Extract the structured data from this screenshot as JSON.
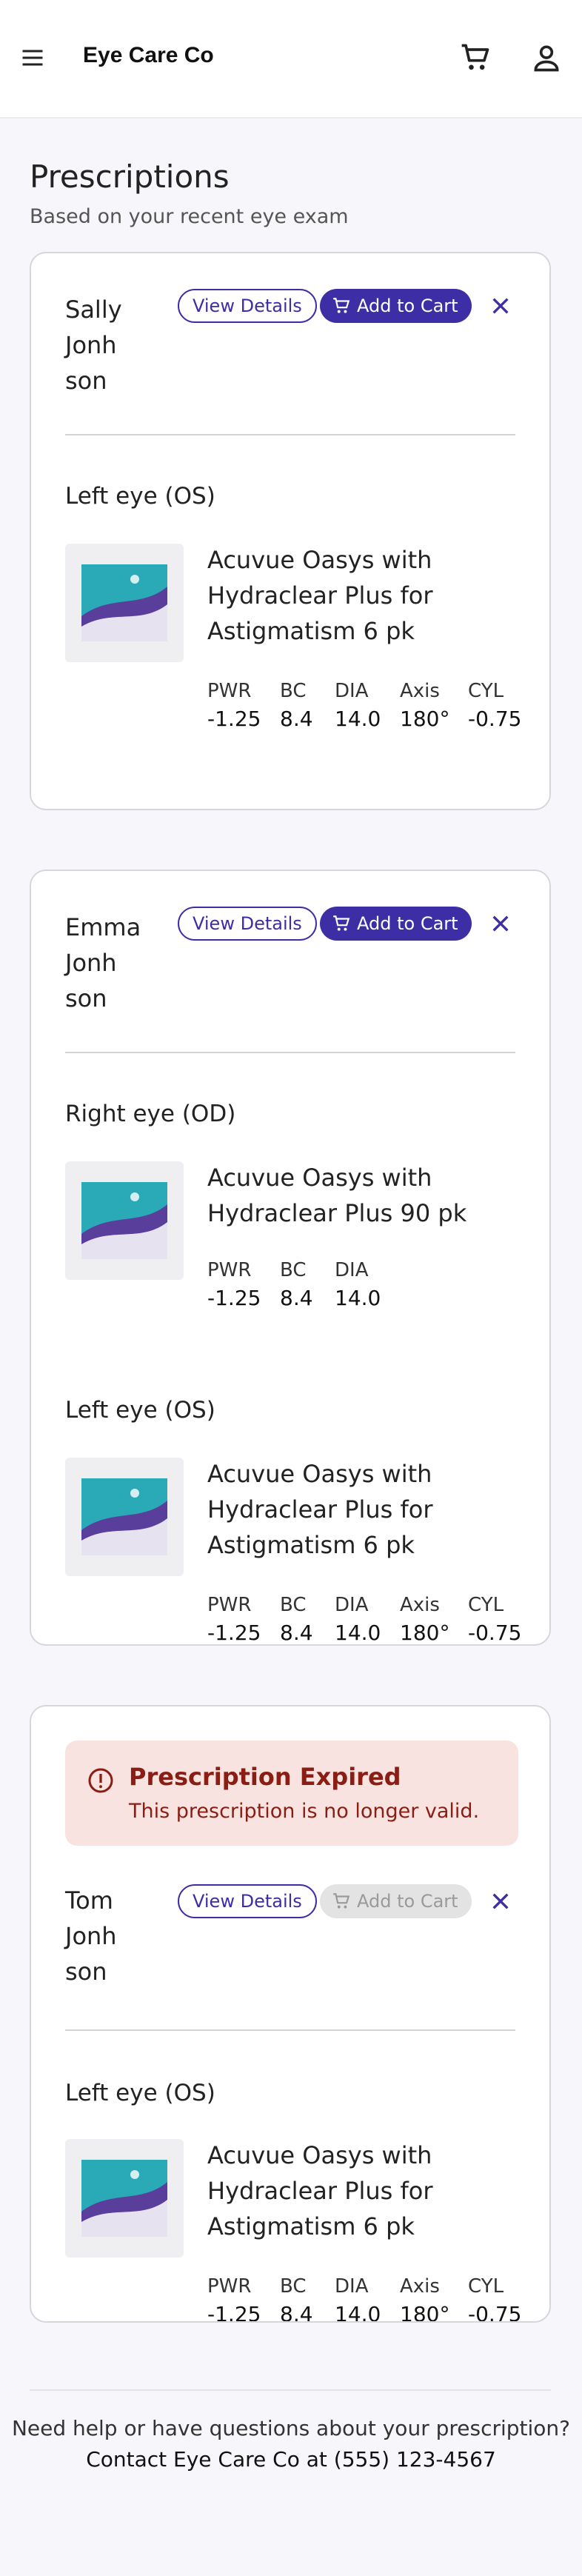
{
  "header": {
    "brand": "Eye Care Co"
  },
  "page": {
    "title": "Prescriptions",
    "subtitle": "Based on your recent eye exam"
  },
  "labels": {
    "view_details": "View Details",
    "add_to_cart": "Add to Cart"
  },
  "spec_labels": {
    "pwr": "PWR",
    "bc": "BC",
    "dia": "DIA",
    "axis": "Axis",
    "cyl": "CYL"
  },
  "cards": [
    {
      "patient": [
        "Sally",
        "Jonh",
        "son"
      ],
      "eyes": [
        {
          "label": "Left eye (OS)",
          "product": [
            "Acuvue Oasys with",
            "Hydraclear Plus for",
            "Astigmatism 6 pk"
          ],
          "pwr": "-1.25",
          "bc": "8.4",
          "dia": "14.0",
          "axis": "180°",
          "cyl": "-0.75"
        }
      ]
    },
    {
      "patient": [
        "Emma",
        "Jonh",
        "son"
      ],
      "eyes": [
        {
          "label": "Right eye (OD)",
          "product": [
            "Acuvue Oasys with",
            "Hydraclear Plus 90 pk"
          ],
          "pwr": "-1.25",
          "bc": "8.4",
          "dia": "14.0"
        },
        {
          "label": "Left eye (OS)",
          "product": [
            "Acuvue Oasys with",
            "Hydraclear Plus for",
            "Astigmatism 6 pk"
          ],
          "pwr": "-1.25",
          "bc": "8.4",
          "dia": "14.0",
          "axis": "180°",
          "cyl": "-0.75"
        }
      ]
    },
    {
      "alert": {
        "title": "Prescription Expired",
        "message": "This prescription is no longer valid."
      },
      "patient": [
        "Tom",
        "Jonh",
        "son"
      ],
      "eyes": [
        {
          "label": "Left eye (OS)",
          "product": [
            "Acuvue Oasys with",
            "Hydraclear Plus for",
            "Astigmatism 6 pk"
          ],
          "pwr": "-1.25",
          "bc": "8.4",
          "dia": "14.0",
          "axis": "180°",
          "cyl": "-0.75"
        }
      ]
    }
  ],
  "footer": {
    "line1": "Need help or have questions about your prescription?",
    "line2": "Contact Eye Care Co at (555) 123-4567"
  },
  "colors": {
    "accent": "#3d2ea6",
    "alert_bg": "#f8e3e0",
    "alert_text": "#8a1d14"
  },
  "icons": [
    "menu-icon",
    "cart-icon",
    "account-icon",
    "close-icon",
    "alert-icon"
  ]
}
